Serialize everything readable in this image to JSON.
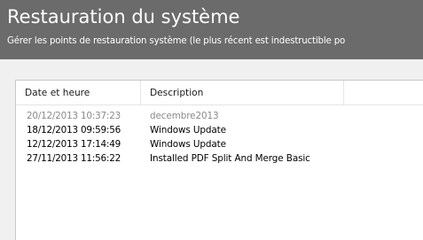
{
  "header": {
    "title": "Restauration du système",
    "subtitle": "Gérer les points de restauration système (le plus récent est indestructible po"
  },
  "table": {
    "columns": [
      "Date et heure",
      "Description",
      ""
    ],
    "rows": [
      {
        "date": "20/12/2013 10:37:23",
        "description": "decembre2013",
        "dimmed": true
      },
      {
        "date": "18/12/2013 09:59:56",
        "description": "Windows Update",
        "dimmed": false
      },
      {
        "date": "12/12/2013 17:14:49",
        "description": "Windows Update",
        "dimmed": false
      },
      {
        "date": "27/11/2013 11:56:22",
        "description": "Installed PDF Split And Merge Basic",
        "dimmed": false
      }
    ]
  },
  "colors": {
    "header_bg": "#6b6b6b",
    "panel_bg": "#f0f0f0",
    "dimmed_text": "#8a8a8a"
  }
}
